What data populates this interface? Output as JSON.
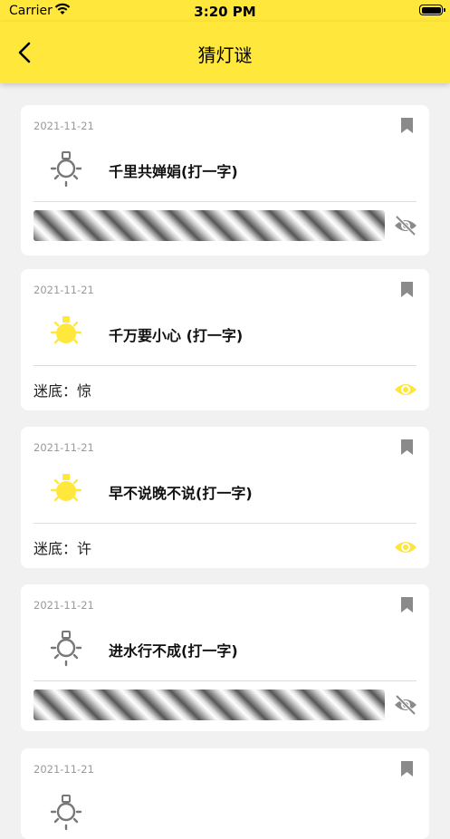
{
  "status_bar": {
    "carrier": "Carrier",
    "time": "3:20 PM"
  },
  "nav": {
    "title": "猜灯谜"
  },
  "colors": {
    "accent": "#ffe83b",
    "lit_bulb": "#ffe83b",
    "unlit_bulb": "#777777",
    "eye_visible": "#ffe43a",
    "eye_hidden": "#8a8a8a"
  },
  "cards": [
    {
      "date": "2021-11-21",
      "riddle": "千里共婵娟(打一字)",
      "lit": false,
      "revealed": false,
      "answer": ""
    },
    {
      "date": "2021-11-21",
      "riddle": "千万要小心 (打一字)",
      "lit": true,
      "revealed": true,
      "answer": "迷底：惊"
    },
    {
      "date": "2021-11-21",
      "riddle": "早不说晚不说(打一字)",
      "lit": true,
      "revealed": true,
      "answer": "迷底：许"
    },
    {
      "date": "2021-11-21",
      "riddle": "进水行不成(打一字)",
      "lit": false,
      "revealed": false,
      "answer": ""
    },
    {
      "date": "2021-11-21",
      "riddle": "",
      "lit": false,
      "revealed": false,
      "answer": ""
    }
  ]
}
